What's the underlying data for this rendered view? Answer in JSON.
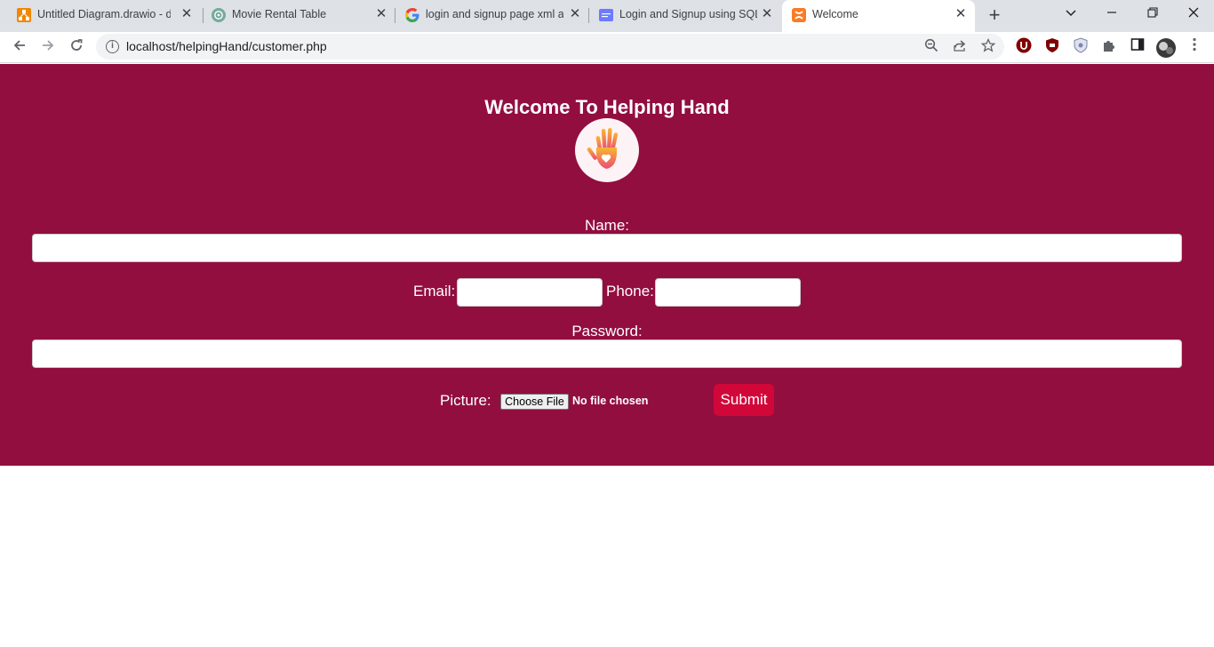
{
  "browser": {
    "tabs": [
      {
        "title": "Untitled Diagram.drawio - dr",
        "favicon": "drawio-icon",
        "color": "#f08705"
      },
      {
        "title": "Movie Rental Table",
        "favicon": "chatgpt-icon",
        "color": "#74aa9c"
      },
      {
        "title": "login and signup page xml ar",
        "favicon": "google-icon",
        "color": "#4285f4"
      },
      {
        "title": "Login and Signup using SQLi",
        "favicon": "site-icon",
        "color": "#6c7bff"
      },
      {
        "title": "Welcome",
        "favicon": "xampp-icon",
        "color": "#fb7a24",
        "active": true
      }
    ],
    "close_glyph": "✕",
    "new_tab_glyph": "+",
    "url": "localhost/helpingHand/customer.php"
  },
  "page": {
    "heading": "Welcome To Helping Hand",
    "background": "#920e3f",
    "form": {
      "name_label": "Name:",
      "email_label": "Email:",
      "phone_label": "Phone:",
      "password_label": "Password:",
      "picture_label": "Picture:",
      "file_button": "Choose File",
      "file_status": "No file chosen",
      "submit_label": "Submit",
      "submit_color": "#d1073a"
    }
  }
}
